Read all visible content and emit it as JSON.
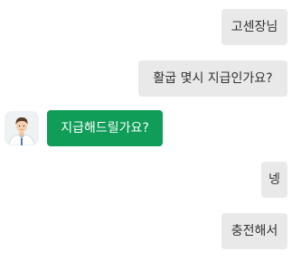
{
  "chat": {
    "messages": [
      {
        "sender": "me",
        "text": "고센장님"
      },
      {
        "sender": "me",
        "text": "활굽 몇시 지급인가요?"
      },
      {
        "sender": "other",
        "text": "지급해드릴가요?",
        "avatar_icon": "male-user-avatar"
      },
      {
        "sender": "me",
        "text": "넹"
      },
      {
        "sender": "me",
        "text": "충전해서"
      }
    ]
  },
  "colors": {
    "my_bubble": "#e9e9e9",
    "my_text": "#333333",
    "their_bubble": "#0f9d58",
    "their_text": "#ffffff"
  }
}
